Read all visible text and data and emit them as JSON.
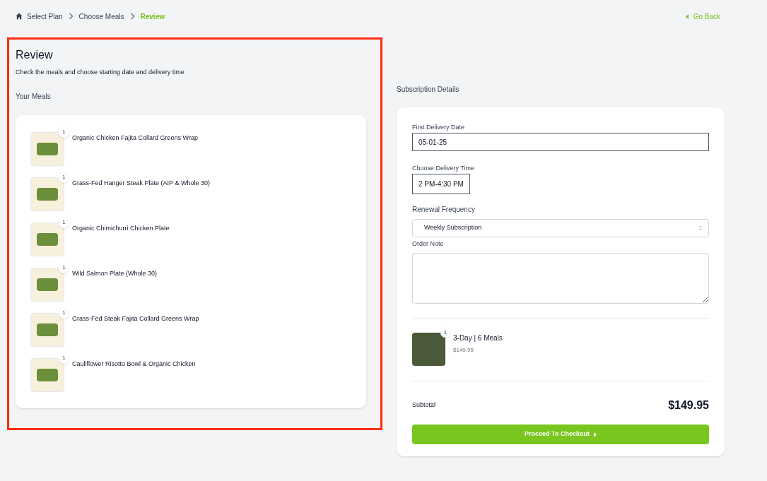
{
  "breadcrumb": [
    {
      "label": "Select Plan",
      "selected": false
    },
    {
      "label": "Choose Meals",
      "selected": false
    },
    {
      "label": "Review",
      "selected": true
    }
  ],
  "go_back": "Go Back",
  "review": {
    "title": "Review",
    "subtitle": "Check the meals and choose starting date and delivery time",
    "meals_heading": "Your Meals",
    "meals": [
      {
        "name": "Organic Chicken Fajita Collard Greens Wrap",
        "quantity": "1"
      },
      {
        "name": "Grass-Fed Hanger Steak Plate (AIP & Whole 30)",
        "quantity": "1"
      },
      {
        "name": "Organic Chimichurri Chicken Plate",
        "quantity": "1"
      },
      {
        "name": "Wild Salmon Plate (Whole 30)",
        "quantity": "1"
      },
      {
        "name": "Grass-Fed Steak Fajita Collard Greens Wrap",
        "quantity": "1"
      },
      {
        "name": "Cauliflower Risotto Bowl & Organic Chicken",
        "quantity": "1"
      }
    ]
  },
  "subscription": {
    "heading": "Subscription Details",
    "first_delivery_date": {
      "label": "First Delivery Date",
      "value": "05-01-25"
    },
    "delivery_time": {
      "label": "Choose Delivery Time",
      "value": "2 PM-4:30 PM"
    },
    "renewal_frequency": {
      "label": "Renewal Frequency",
      "value": "Weekly Subscription"
    },
    "order_note": {
      "label": "Order Note"
    },
    "plan": {
      "name": "3-Day | 6 Meals",
      "price": "$149.95",
      "quantity": "1"
    },
    "subtotal_label": "Subtotal",
    "subtotal": "$149.95",
    "checkout_button": "Proceed To Checkout"
  }
}
